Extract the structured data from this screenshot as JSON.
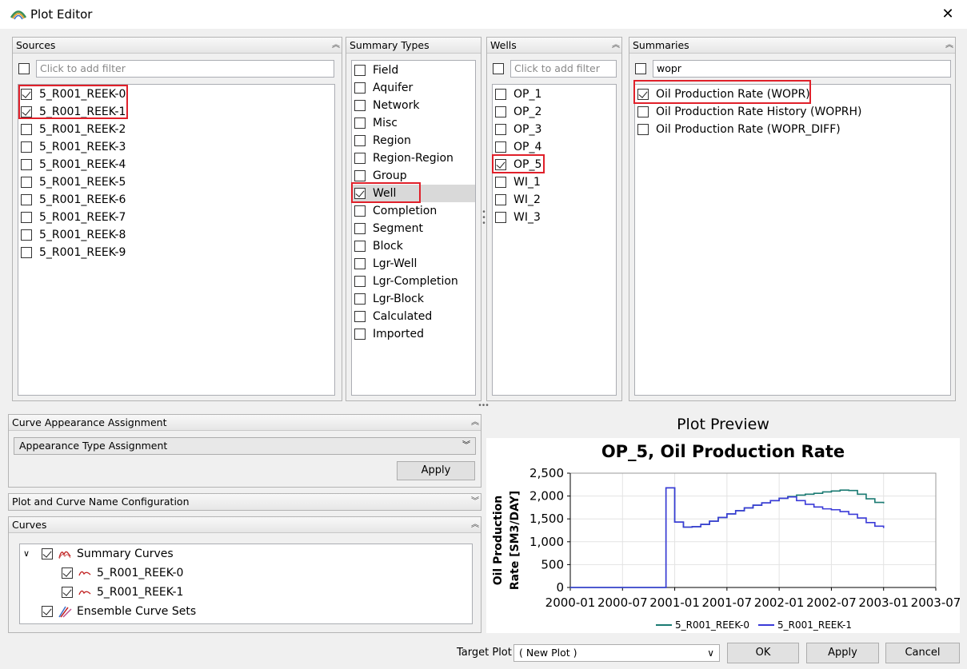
{
  "window": {
    "title": "Plot Editor",
    "close_symbol": "✕"
  },
  "sources": {
    "header": "Sources",
    "filter_placeholder": "Click to add filter",
    "items": [
      {
        "label": "5_R001_REEK-0",
        "checked": true
      },
      {
        "label": "5_R001_REEK-1",
        "checked": true
      },
      {
        "label": "5_R001_REEK-2",
        "checked": false
      },
      {
        "label": "5_R001_REEK-3",
        "checked": false
      },
      {
        "label": "5_R001_REEK-4",
        "checked": false
      },
      {
        "label": "5_R001_REEK-5",
        "checked": false
      },
      {
        "label": "5_R001_REEK-6",
        "checked": false
      },
      {
        "label": "5_R001_REEK-7",
        "checked": false
      },
      {
        "label": "5_R001_REEK-8",
        "checked": false
      },
      {
        "label": "5_R001_REEK-9",
        "checked": false
      }
    ]
  },
  "summary_types": {
    "header": "Summary Types",
    "items": [
      {
        "label": "Field",
        "checked": false
      },
      {
        "label": "Aquifer",
        "checked": false
      },
      {
        "label": "Network",
        "checked": false
      },
      {
        "label": "Misc",
        "checked": false
      },
      {
        "label": "Region",
        "checked": false
      },
      {
        "label": "Region-Region",
        "checked": false
      },
      {
        "label": "Group",
        "checked": false
      },
      {
        "label": "Well",
        "checked": true
      },
      {
        "label": "Completion",
        "checked": false
      },
      {
        "label": "Segment",
        "checked": false
      },
      {
        "label": "Block",
        "checked": false
      },
      {
        "label": "Lgr-Well",
        "checked": false
      },
      {
        "label": "Lgr-Completion",
        "checked": false
      },
      {
        "label": "Lgr-Block",
        "checked": false
      },
      {
        "label": "Calculated",
        "checked": false
      },
      {
        "label": "Imported",
        "checked": false
      }
    ]
  },
  "wells": {
    "header": "Wells",
    "filter_placeholder": "Click to add filter",
    "items": [
      {
        "label": "OP_1",
        "checked": false
      },
      {
        "label": "OP_2",
        "checked": false
      },
      {
        "label": "OP_3",
        "checked": false
      },
      {
        "label": "OP_4",
        "checked": false
      },
      {
        "label": "OP_5",
        "checked": true
      },
      {
        "label": "WI_1",
        "checked": false
      },
      {
        "label": "WI_2",
        "checked": false
      },
      {
        "label": "WI_3",
        "checked": false
      }
    ]
  },
  "summaries": {
    "header": "Summaries",
    "filter_value": "wopr",
    "items": [
      {
        "label": "Oil Production Rate (WOPR)",
        "checked": true
      },
      {
        "label": "Oil Production Rate History (WOPRH)",
        "checked": false
      },
      {
        "label": "Oil Production Rate (WOPR_DIFF)",
        "checked": false
      }
    ]
  },
  "curve_appearance": {
    "header": "Curve Appearance Assignment",
    "combo_value": "Appearance Type Assignment",
    "apply_label": "Apply"
  },
  "plot_curve_name": {
    "header": "Plot and Curve Name Configuration"
  },
  "curves": {
    "header": "Curves",
    "summary_curves_label": "Summary Curves",
    "children": [
      "5_R001_REEK-0",
      "5_R001_REEK-1"
    ],
    "ensemble_label": "Ensemble Curve Sets"
  },
  "preview": {
    "label": "Plot Preview"
  },
  "chart_data": {
    "type": "line",
    "title": "OP_5, Oil Production Rate",
    "ylabel": "Oil Production\nRate [SM3/DAY]",
    "xlabel": "",
    "x_ticks": [
      "2000-01",
      "2000-07",
      "2001-01",
      "2001-07",
      "2002-01",
      "2002-07",
      "2003-01",
      "2003-07"
    ],
    "y_ticks": [
      "0",
      "500",
      "1,000",
      "1,500",
      "2,000",
      "2,500"
    ],
    "ylim": [
      0,
      2500
    ],
    "xlim": [
      "2000-01",
      "2003-07"
    ],
    "legend_position": "bottom",
    "grid": true,
    "series": [
      {
        "name": "5_R001_REEK-0",
        "color": "#1a7a72",
        "x": [
          "2000-01",
          "2000-12",
          "2000-12",
          "2001-01",
          "2001-01",
          "2001-02",
          "2001-03",
          "2001-04",
          "2001-05",
          "2001-06",
          "2001-07",
          "2001-08",
          "2001-09",
          "2001-10",
          "2001-11",
          "2001-12",
          "2002-01",
          "2002-02",
          "2002-03",
          "2002-04",
          "2002-05",
          "2002-06",
          "2002-07",
          "2002-08",
          "2002-09",
          "2002-10",
          "2002-11",
          "2002-12",
          "2003-01"
        ],
        "y": [
          0,
          0,
          2180,
          2180,
          1430,
          1320,
          1330,
          1380,
          1450,
          1530,
          1610,
          1680,
          1740,
          1800,
          1850,
          1900,
          1950,
          1990,
          2020,
          2040,
          2060,
          2090,
          2110,
          2130,
          2120,
          2040,
          1940,
          1860,
          1840
        ]
      },
      {
        "name": "5_R001_REEK-1",
        "color": "#3a3ad8",
        "x": [
          "2000-01",
          "2000-12",
          "2000-12",
          "2001-01",
          "2001-01",
          "2001-02",
          "2001-03",
          "2001-04",
          "2001-05",
          "2001-06",
          "2001-07",
          "2001-08",
          "2001-09",
          "2001-10",
          "2001-11",
          "2001-12",
          "2002-01",
          "2002-02",
          "2002-03",
          "2002-04",
          "2002-05",
          "2002-06",
          "2002-07",
          "2002-08",
          "2002-09",
          "2002-10",
          "2002-11",
          "2002-12",
          "2003-01"
        ],
        "y": [
          0,
          0,
          2180,
          2180,
          1430,
          1320,
          1330,
          1380,
          1450,
          1530,
          1610,
          1680,
          1740,
          1800,
          1850,
          1900,
          1950,
          1980,
          1900,
          1820,
          1760,
          1720,
          1700,
          1660,
          1600,
          1520,
          1420,
          1340,
          1300
        ]
      }
    ]
  },
  "footer": {
    "target_plot_label": "Target Plot",
    "target_plot_value": "( New Plot )",
    "ok_label": "OK",
    "apply_label": "Apply",
    "cancel_label": "Cancel"
  },
  "icons": {
    "app": "ribbon-logo-icon",
    "collapse": "double-chevron-up-icon",
    "expand": "double-chevron-down-icon",
    "splitter": "splitter-dots-icon",
    "summary_curves": "summary-curves-icon",
    "curve": "curve-icon",
    "ensemble": "ensemble-curves-icon"
  },
  "colors": {
    "highlight_red": "#e0202a",
    "selection_gray": "#d9d9d9"
  }
}
